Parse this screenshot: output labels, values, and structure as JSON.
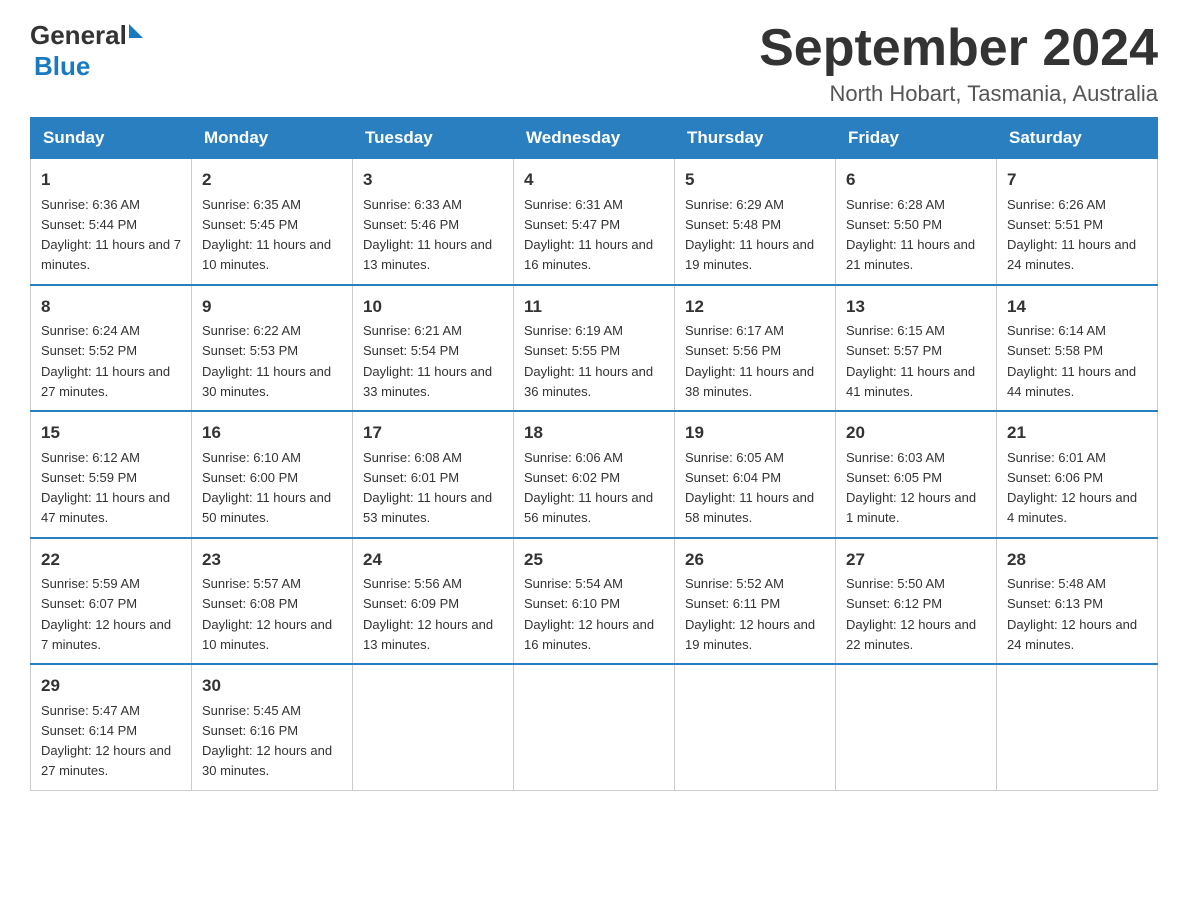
{
  "logo": {
    "general": "General",
    "blue": "Blue"
  },
  "title": "September 2024",
  "subtitle": "North Hobart, Tasmania, Australia",
  "weekdays": [
    "Sunday",
    "Monday",
    "Tuesday",
    "Wednesday",
    "Thursday",
    "Friday",
    "Saturday"
  ],
  "weeks": [
    [
      {
        "day": "1",
        "sunrise": "6:36 AM",
        "sunset": "5:44 PM",
        "daylight": "11 hours and 7 minutes."
      },
      {
        "day": "2",
        "sunrise": "6:35 AM",
        "sunset": "5:45 PM",
        "daylight": "11 hours and 10 minutes."
      },
      {
        "day": "3",
        "sunrise": "6:33 AM",
        "sunset": "5:46 PM",
        "daylight": "11 hours and 13 minutes."
      },
      {
        "day": "4",
        "sunrise": "6:31 AM",
        "sunset": "5:47 PM",
        "daylight": "11 hours and 16 minutes."
      },
      {
        "day": "5",
        "sunrise": "6:29 AM",
        "sunset": "5:48 PM",
        "daylight": "11 hours and 19 minutes."
      },
      {
        "day": "6",
        "sunrise": "6:28 AM",
        "sunset": "5:50 PM",
        "daylight": "11 hours and 21 minutes."
      },
      {
        "day": "7",
        "sunrise": "6:26 AM",
        "sunset": "5:51 PM",
        "daylight": "11 hours and 24 minutes."
      }
    ],
    [
      {
        "day": "8",
        "sunrise": "6:24 AM",
        "sunset": "5:52 PM",
        "daylight": "11 hours and 27 minutes."
      },
      {
        "day": "9",
        "sunrise": "6:22 AM",
        "sunset": "5:53 PM",
        "daylight": "11 hours and 30 minutes."
      },
      {
        "day": "10",
        "sunrise": "6:21 AM",
        "sunset": "5:54 PM",
        "daylight": "11 hours and 33 minutes."
      },
      {
        "day": "11",
        "sunrise": "6:19 AM",
        "sunset": "5:55 PM",
        "daylight": "11 hours and 36 minutes."
      },
      {
        "day": "12",
        "sunrise": "6:17 AM",
        "sunset": "5:56 PM",
        "daylight": "11 hours and 38 minutes."
      },
      {
        "day": "13",
        "sunrise": "6:15 AM",
        "sunset": "5:57 PM",
        "daylight": "11 hours and 41 minutes."
      },
      {
        "day": "14",
        "sunrise": "6:14 AM",
        "sunset": "5:58 PM",
        "daylight": "11 hours and 44 minutes."
      }
    ],
    [
      {
        "day": "15",
        "sunrise": "6:12 AM",
        "sunset": "5:59 PM",
        "daylight": "11 hours and 47 minutes."
      },
      {
        "day": "16",
        "sunrise": "6:10 AM",
        "sunset": "6:00 PM",
        "daylight": "11 hours and 50 minutes."
      },
      {
        "day": "17",
        "sunrise": "6:08 AM",
        "sunset": "6:01 PM",
        "daylight": "11 hours and 53 minutes."
      },
      {
        "day": "18",
        "sunrise": "6:06 AM",
        "sunset": "6:02 PM",
        "daylight": "11 hours and 56 minutes."
      },
      {
        "day": "19",
        "sunrise": "6:05 AM",
        "sunset": "6:04 PM",
        "daylight": "11 hours and 58 minutes."
      },
      {
        "day": "20",
        "sunrise": "6:03 AM",
        "sunset": "6:05 PM",
        "daylight": "12 hours and 1 minute."
      },
      {
        "day": "21",
        "sunrise": "6:01 AM",
        "sunset": "6:06 PM",
        "daylight": "12 hours and 4 minutes."
      }
    ],
    [
      {
        "day": "22",
        "sunrise": "5:59 AM",
        "sunset": "6:07 PM",
        "daylight": "12 hours and 7 minutes."
      },
      {
        "day": "23",
        "sunrise": "5:57 AM",
        "sunset": "6:08 PM",
        "daylight": "12 hours and 10 minutes."
      },
      {
        "day": "24",
        "sunrise": "5:56 AM",
        "sunset": "6:09 PM",
        "daylight": "12 hours and 13 minutes."
      },
      {
        "day": "25",
        "sunrise": "5:54 AM",
        "sunset": "6:10 PM",
        "daylight": "12 hours and 16 minutes."
      },
      {
        "day": "26",
        "sunrise": "5:52 AM",
        "sunset": "6:11 PM",
        "daylight": "12 hours and 19 minutes."
      },
      {
        "day": "27",
        "sunrise": "5:50 AM",
        "sunset": "6:12 PM",
        "daylight": "12 hours and 22 minutes."
      },
      {
        "day": "28",
        "sunrise": "5:48 AM",
        "sunset": "6:13 PM",
        "daylight": "12 hours and 24 minutes."
      }
    ],
    [
      {
        "day": "29",
        "sunrise": "5:47 AM",
        "sunset": "6:14 PM",
        "daylight": "12 hours and 27 minutes."
      },
      {
        "day": "30",
        "sunrise": "5:45 AM",
        "sunset": "6:16 PM",
        "daylight": "12 hours and 30 minutes."
      },
      null,
      null,
      null,
      null,
      null
    ]
  ],
  "labels": {
    "sunrise": "Sunrise:",
    "sunset": "Sunset:",
    "daylight": "Daylight:"
  }
}
